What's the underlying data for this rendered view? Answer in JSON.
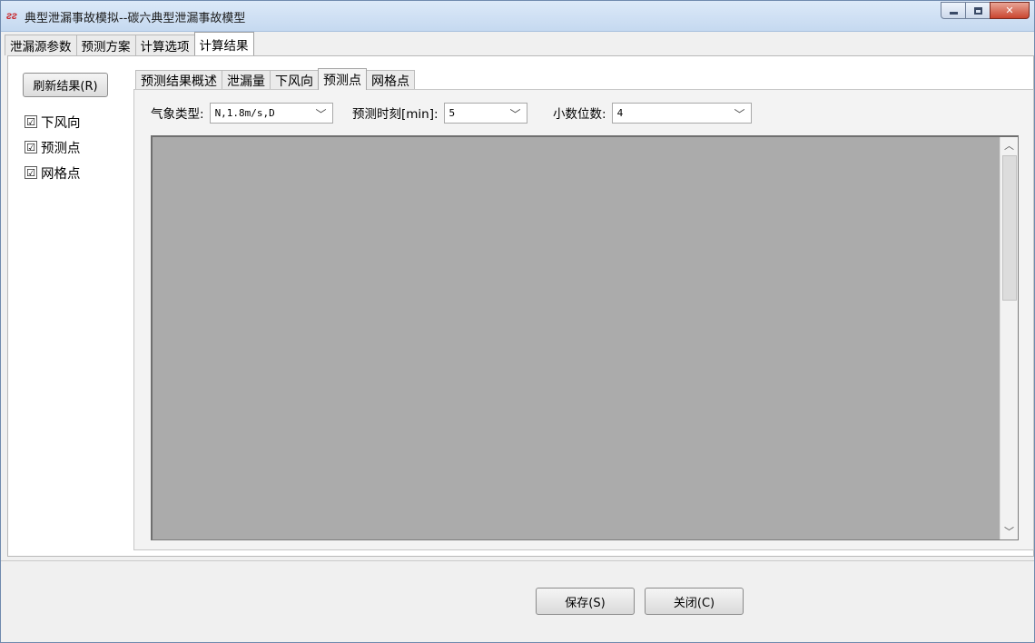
{
  "window": {
    "icon": "ᴤᴤ",
    "title": "典型泄漏事故模拟--碳六典型泄漏事故模型"
  },
  "top_tabs": [
    {
      "label": "泄漏源参数"
    },
    {
      "label": "预测方案"
    },
    {
      "label": "计算选项"
    },
    {
      "label": "计算结果"
    }
  ],
  "left_panel": {
    "refresh_label": "刷新结果(R)",
    "checkboxes": [
      {
        "label": "下风向",
        "checked": "☑"
      },
      {
        "label": "预测点",
        "checked": "☑"
      },
      {
        "label": "网格点",
        "checked": "☑"
      }
    ]
  },
  "inner_tabs": [
    {
      "label": "预测结果概述"
    },
    {
      "label": "泄漏量"
    },
    {
      "label": "下风向"
    },
    {
      "label": "预测点"
    },
    {
      "label": "网格点"
    }
  ],
  "filters": {
    "weather": {
      "label": "气象类型:",
      "value": "N,1.8m/s,D"
    },
    "time": {
      "label": "预测时刻[min]:",
      "value": "5"
    },
    "decimals": {
      "label": "小数位数:",
      "value": "4"
    }
  },
  "buttons": {
    "save_label": "保存(S)",
    "close_label": "关闭(C)"
  }
}
